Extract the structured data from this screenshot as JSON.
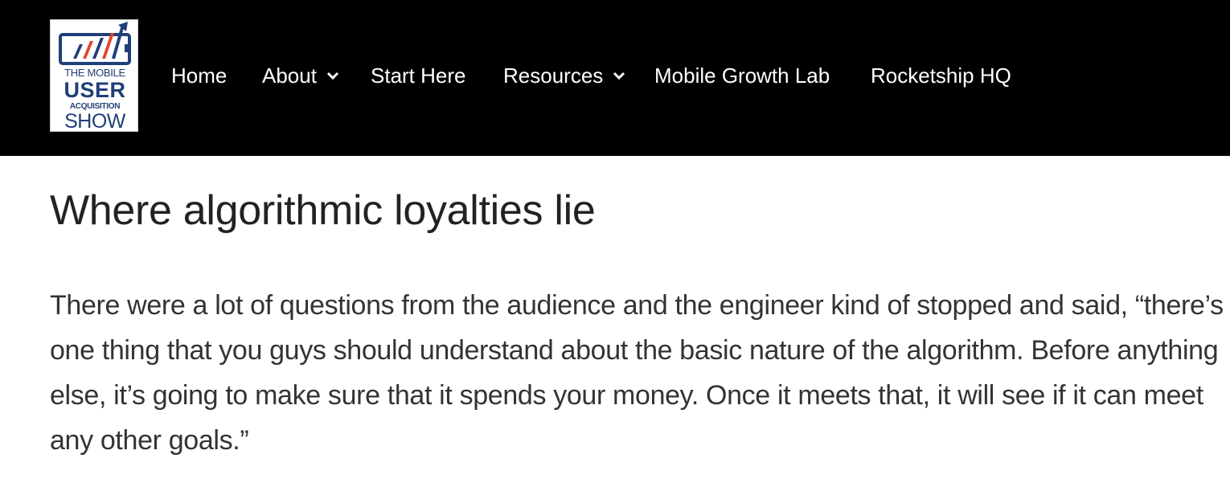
{
  "header": {
    "logo": {
      "line1": "THE MOBILE",
      "line2": "USER",
      "line3": "ACQUISITION",
      "line4": "SHOW",
      "icon": "rising-bar-chart-phone-icon",
      "colors": {
        "blue": "#1f3f78",
        "red": "#e2452b"
      }
    },
    "nav": [
      {
        "label": "Home"
      },
      {
        "label": "About",
        "has_dropdown": true
      },
      {
        "label": "Start Here"
      },
      {
        "label": "Resources",
        "has_dropdown": true
      },
      {
        "label": "Mobile Growth Lab"
      },
      {
        "label": "Rocketship HQ"
      }
    ],
    "background": "#000000",
    "nav_text_color": "#ffffff"
  },
  "article": {
    "title": "Where algorithmic loyalties lie",
    "paragraph": "There were a lot of questions from the audience and the engineer kind of stopped and said, “there’s one thing that you guys should understand about the basic nature of the algorithm. Before anything else, it’s going to make sure that it spends your money. Once it meets that, it will see if it can meet any other goals.”"
  }
}
